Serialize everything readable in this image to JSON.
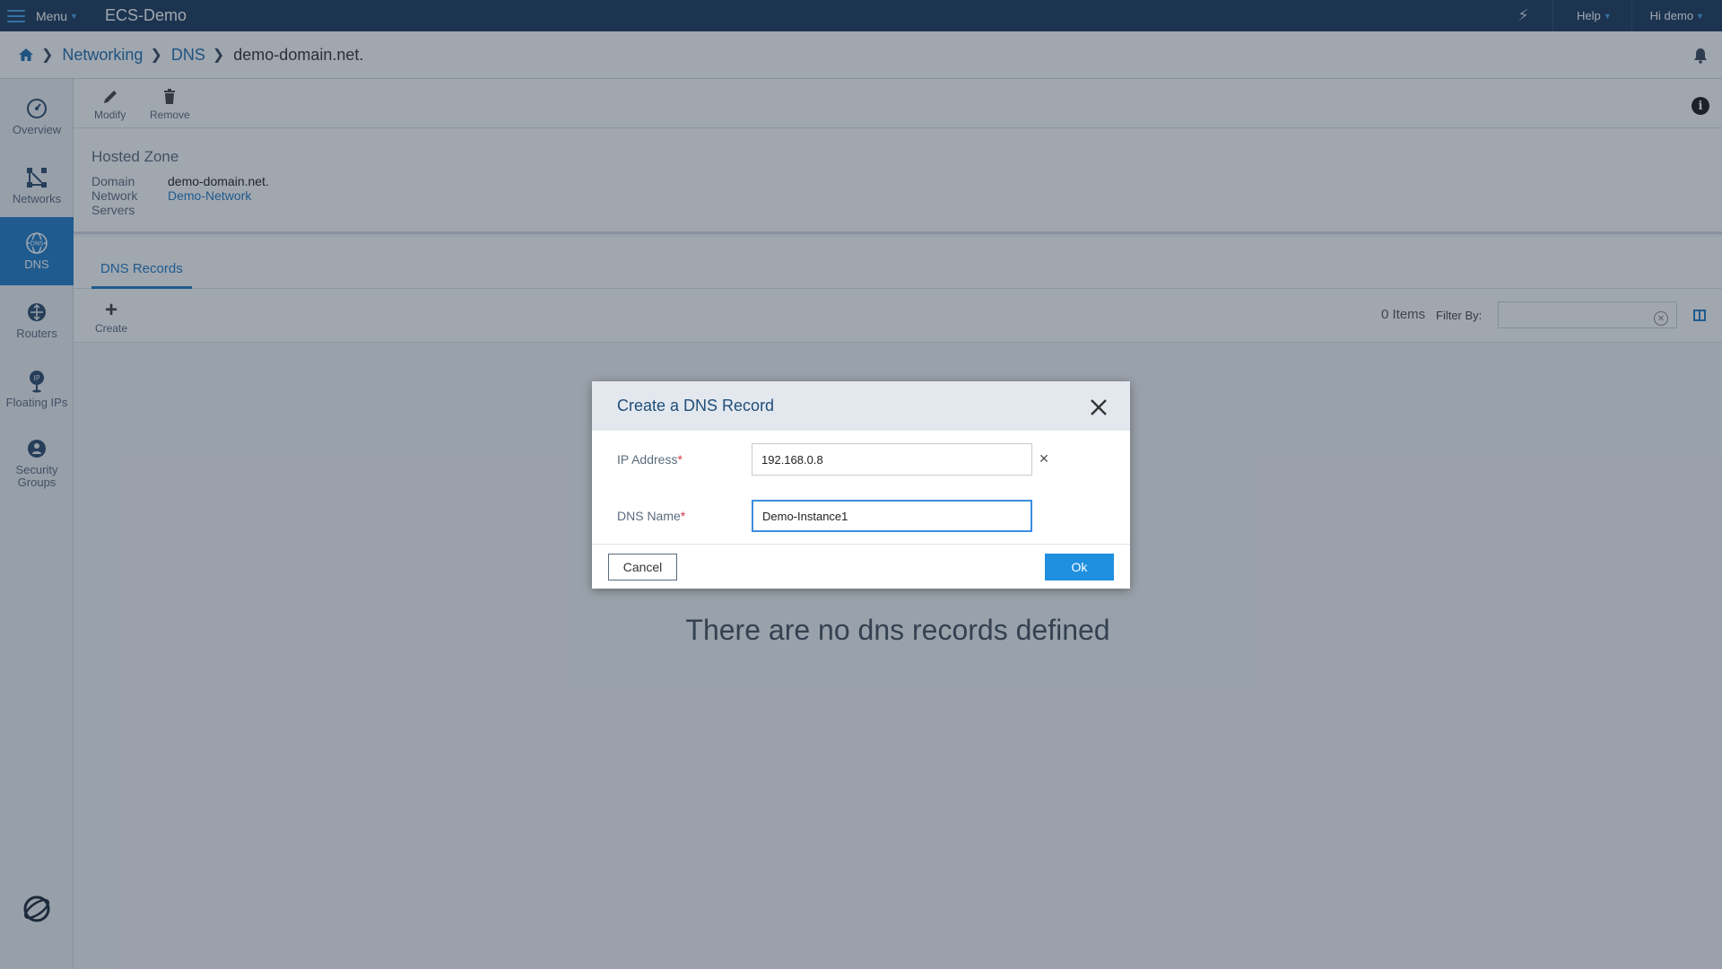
{
  "topbar": {
    "menu_label": "Menu",
    "app_title": "ECS-Demo",
    "help_label": "Help",
    "user_label": "Hi demo",
    "bolt_icon": "lightning-icon"
  },
  "breadcrumb": {
    "items": [
      "Networking",
      "DNS"
    ],
    "current": "demo-domain.net."
  },
  "sidebar": {
    "items": [
      {
        "label": "Overview",
        "icon": "dashboard-icon",
        "active": false
      },
      {
        "label": "Networks",
        "icon": "network-icon",
        "active": false
      },
      {
        "label": "DNS",
        "icon": "dns-globe-icon",
        "active": true
      },
      {
        "label": "Routers",
        "icon": "router-icon",
        "active": false
      },
      {
        "label": "Floating IPs",
        "icon": "floating-ip-icon",
        "active": false
      },
      {
        "label": "Security Groups",
        "icon": "security-group-icon",
        "active": false
      }
    ]
  },
  "toolbar": {
    "modify_label": "Modify",
    "remove_label": "Remove"
  },
  "zone": {
    "title": "Hosted Zone",
    "domain_key": "Domain",
    "domain_value": "demo-domain.net.",
    "network_key": "Network",
    "network_value": "Demo-Network",
    "servers_key": "Servers"
  },
  "tabs": {
    "dns_records": "DNS Records"
  },
  "listbar": {
    "create_label": "Create",
    "items_count": "0 Items",
    "filter_label": "Filter By:"
  },
  "empty_message": "There are no dns records defined",
  "modal": {
    "title": "Create a DNS Record",
    "ip_label": "IP Address",
    "ip_value": "192.168.0.8",
    "dns_label": "DNS Name",
    "dns_value": "Demo-Instance1",
    "required_mark": "*",
    "cancel_label": "Cancel",
    "ok_label": "Ok"
  },
  "colors": {
    "topbar": "#1b3a5c",
    "accent": "#1f7cc7",
    "ok_button": "#1f8fe0",
    "required": "#d9344a"
  }
}
